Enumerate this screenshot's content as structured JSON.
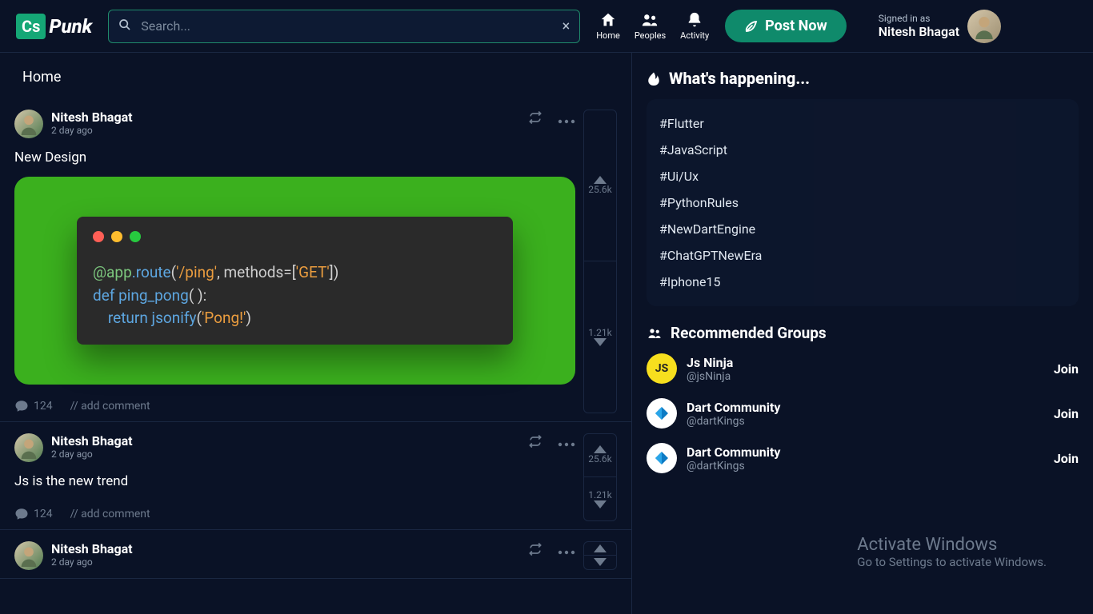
{
  "brand": {
    "badge": "Cs",
    "name": "Punk"
  },
  "search": {
    "placeholder": "Search..."
  },
  "nav": {
    "home": "Home",
    "peoples": "Peoples",
    "activity": "Activity"
  },
  "postNow": "Post Now",
  "user": {
    "signedInAs": "Signed in as",
    "name": "Nitesh Bhagat"
  },
  "feedTitle": "Home",
  "posts": [
    {
      "author": "Nitesh Bhagat",
      "time": "2 day ago",
      "text": "New Design",
      "hasCode": true,
      "code": {
        "l1_dec": "@app",
        "l1_fn": ".route",
        "l1_p1": "(",
        "l1_s1": "'/ping'",
        "l1_p2": ", methods=[",
        "l1_s2": "'GET'",
        "l1_p3": "])",
        "l2_kw": "def ",
        "l2_fn": "ping_pong",
        "l2_p": "( ):",
        "l3_kw": "    return ",
        "l3_fn": "jsonify",
        "l3_p1": "(",
        "l3_s": "'Pong!'",
        "l3_p2": ")"
      },
      "comments": "124",
      "addComment": "// add comment",
      "up": "25.6k",
      "down": "1.21k"
    },
    {
      "author": "Nitesh Bhagat",
      "time": "2 day ago",
      "text": "Js is the new trend",
      "hasCode": false,
      "comments": "124",
      "addComment": "// add comment",
      "up": "25.6k",
      "down": "1.21k"
    },
    {
      "author": "Nitesh Bhagat",
      "time": "2 day ago",
      "text": "",
      "hasCode": false,
      "comments": "",
      "addComment": "",
      "up": "",
      "down": ""
    }
  ],
  "happening": {
    "title": "What's happening...",
    "tags": [
      "#Flutter",
      "#JavaScript",
      "#Ui/Ux",
      "#PythonRules",
      "#NewDartEngine",
      "#ChatGPTNewEra",
      "#Iphone15"
    ]
  },
  "groupsTitle": "Recommended Groups",
  "groups": [
    {
      "name": "Js Ninja",
      "handle": "@jsNinja",
      "type": "js",
      "badge": "JS",
      "join": "Join"
    },
    {
      "name": "Dart Community",
      "handle": "@dartKings",
      "type": "dart",
      "badge": "",
      "join": "Join"
    },
    {
      "name": "Dart Community",
      "handle": "@dartKings",
      "type": "dart",
      "badge": "",
      "join": "Join"
    }
  ],
  "watermark": {
    "title": "Activate Windows",
    "sub": "Go to Settings to activate Windows."
  }
}
